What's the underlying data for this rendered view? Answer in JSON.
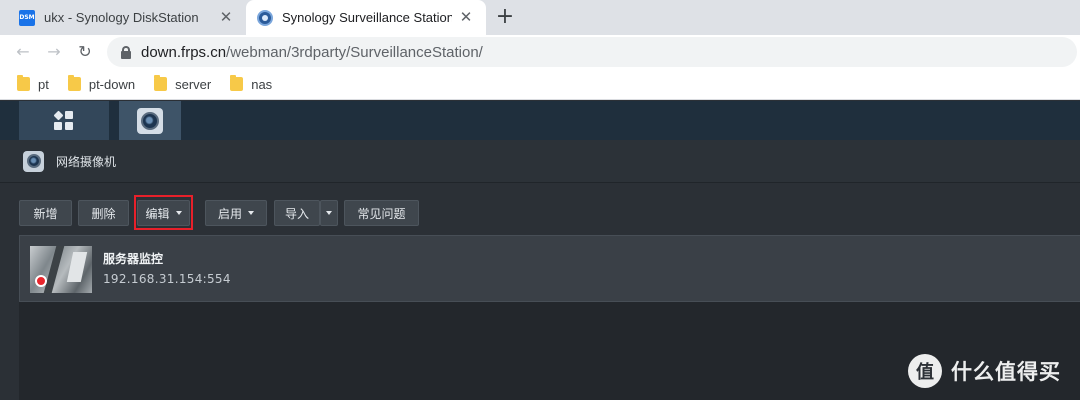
{
  "browser": {
    "tabs": [
      {
        "favicon": "dsm-icon",
        "favicon_text": "DSM",
        "title": "ukx - Synology DiskStation",
        "close": "✕"
      },
      {
        "favicon": "surveillance-station-icon",
        "title": "Synology Surveillance Station",
        "close": "✕"
      }
    ],
    "new_tab": "+",
    "nav": {
      "back": "←",
      "forward": "→",
      "reload": "↻"
    },
    "address": {
      "host": "down.frps.cn",
      "path": "/webman/3rdparty/SurveillanceStation/"
    },
    "bookmarks": [
      {
        "label": "pt"
      },
      {
        "label": "pt-down"
      },
      {
        "label": "server"
      },
      {
        "label": "nas"
      }
    ]
  },
  "dsm": {
    "window_title": "网络摄像机",
    "toolbar": {
      "add": "新增",
      "delete": "删除",
      "edit": "编辑",
      "enable": "启用",
      "import": "导入",
      "faq": "常见问题"
    },
    "cameras": [
      {
        "name": "服务器监控",
        "address": "192.168.31.154:554",
        "status_color": "#e8262d"
      }
    ],
    "highlight_color": "#e8202a"
  },
  "watermark": {
    "logo": "值",
    "text": "什么值得买"
  }
}
